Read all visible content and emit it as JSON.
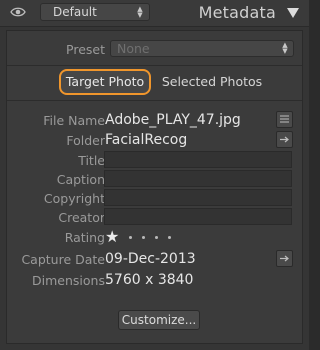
{
  "header": {
    "preset_value": "Default",
    "title": "Metadata"
  },
  "preset": {
    "label": "Preset",
    "value": "None"
  },
  "tabs": [
    {
      "label": "Target Photo",
      "active": true
    },
    {
      "label": "Selected Photos",
      "active": false
    }
  ],
  "fields": {
    "file_name": {
      "label": "File Name",
      "value": "Adobe_PLAY_47.jpg"
    },
    "folder": {
      "label": "Folder",
      "value": "FacialRecog"
    },
    "title": {
      "label": "Title",
      "value": ""
    },
    "caption": {
      "label": "Caption",
      "value": ""
    },
    "copyright": {
      "label": "Copyright",
      "value": ""
    },
    "creator": {
      "label": "Creator",
      "value": ""
    },
    "rating": {
      "label": "Rating",
      "stars": 1,
      "max": 5,
      "star_glyph": "★"
    },
    "capture_date": {
      "label": "Capture Date",
      "value": "09-Dec-2013"
    },
    "dimensions": {
      "label": "Dimensions",
      "value": "5760 x 3840"
    }
  },
  "customize_label": "Customize...",
  "colors": {
    "accent_highlight": "#f0962c",
    "panel_bg": "#3b3b3b"
  },
  "icons": [
    "eye-icon",
    "updown-arrows-icon",
    "collapse-triangle-icon",
    "list-icon",
    "arrow-right-icon"
  ]
}
